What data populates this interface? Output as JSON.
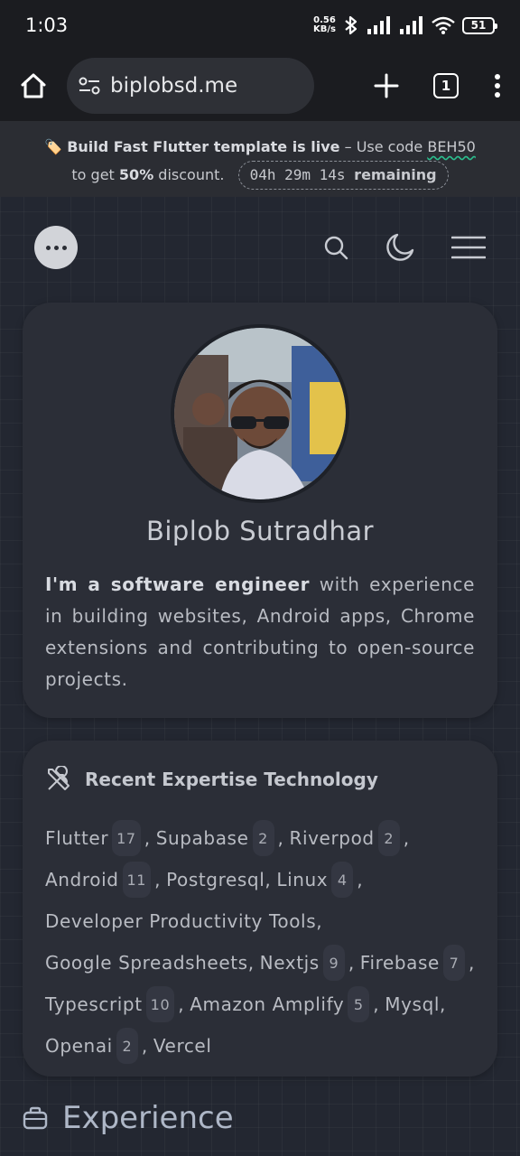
{
  "status_bar": {
    "time": "1:03",
    "net_speed_value": "0.56",
    "net_speed_unit": "KB/s",
    "battery": "51"
  },
  "browser": {
    "url": "biplobsd.me",
    "tab_count": "1",
    "icons": [
      "home-icon",
      "site-settings-icon",
      "plus-icon",
      "tabs-icon",
      "more-vert-icon"
    ]
  },
  "promo": {
    "emoji": "🏷️",
    "headline": "Build Fast Flutter template is live",
    "use_code_text": " – Use code ",
    "code": "BEH50",
    "to_get": "to get ",
    "discount": "50%",
    "discount_suffix": " discount.",
    "countdown_time": "04h 29m 14s",
    "countdown_label": "remaining"
  },
  "nav": {
    "icons": [
      "logo-icon",
      "search-icon",
      "moon-icon",
      "menu-icon"
    ]
  },
  "profile": {
    "name": "Biplob Sutradhar",
    "bio_strong": "I'm a software engineer",
    "bio_rest": " with experience in building websites, Android apps, Chrome extensions and contributing to open-source projects."
  },
  "expertise": {
    "title": "Recent Expertise Technology",
    "icon": "tools-icon",
    "items": [
      {
        "name": "Flutter",
        "count": "17"
      },
      {
        "name": "Supabase",
        "count": "2"
      },
      {
        "name": "Riverpod",
        "count": "2"
      },
      {
        "name": "Android",
        "count": "11"
      },
      {
        "name": "Postgresql",
        "count": ""
      },
      {
        "name": "Linux",
        "count": "4"
      },
      {
        "name": "Developer Productivity Tools",
        "count": ""
      },
      {
        "name": "Google Spreadsheets",
        "count": ""
      },
      {
        "name": "Nextjs",
        "count": "9"
      },
      {
        "name": "Firebase",
        "count": "7"
      },
      {
        "name": "Typescript",
        "count": "10"
      },
      {
        "name": "Amazon Amplify",
        "count": "5"
      },
      {
        "name": "Mysql",
        "count": ""
      },
      {
        "name": "Openai",
        "count": "2"
      },
      {
        "name": "Vercel",
        "count": ""
      }
    ]
  },
  "experience": {
    "title": "Experience",
    "icon": "briefcase-icon"
  },
  "colors": {
    "background": "#232731",
    "card": "#2b2e37",
    "promo_underline": "#2bc08f"
  }
}
